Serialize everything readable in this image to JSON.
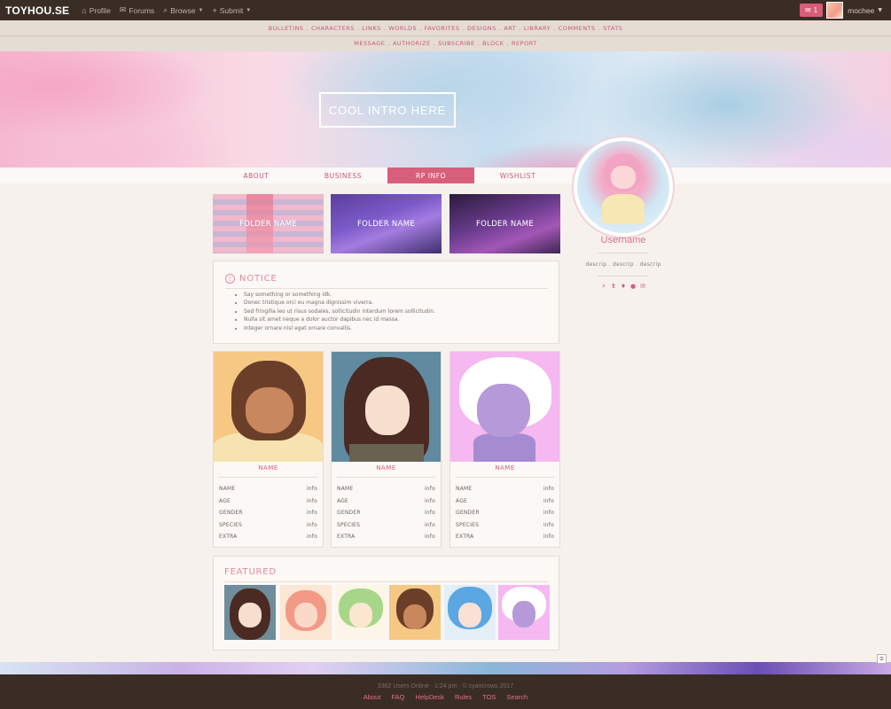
{
  "topbar": {
    "brand": "TOYHOU.SE",
    "nav": [
      {
        "label": "Profile",
        "icon": "home-icon"
      },
      {
        "label": "Forums",
        "icon": "chat-icon"
      },
      {
        "label": "Browse",
        "icon": "search-icon"
      },
      {
        "label": "Submit",
        "icon": "plus-icon"
      }
    ],
    "mail_count": "1",
    "username": "mochee"
  },
  "subnav": {
    "row1": [
      "BULLETINS",
      "CHARACTERS",
      "LINKS",
      "WORLDS",
      "FAVORITES",
      "DESIGNS",
      "ART",
      "LIBRARY",
      "COMMENTS",
      "STATS"
    ],
    "row2": [
      "MESSAGE",
      "AUTHORIZE",
      "SUBSCRIBE",
      "BLOCK",
      "REPORT"
    ],
    "separator": "."
  },
  "banner": {
    "intro": "COOL INTRO HERE"
  },
  "tabs": [
    "ABOUT",
    "BUSINESS",
    "RP INFO",
    "WISHLIST"
  ],
  "active_tab": "RP INFO",
  "aside": {
    "name": "Username",
    "descrip": "descrip . descrip . descrip",
    "social": [
      "bolt-icon",
      "tumblr-icon",
      "twitter-icon",
      "paw-icon",
      "mail-icon"
    ]
  },
  "folders": [
    "FOLDER NAME",
    "FOLDER NAME",
    "FOLDER NAME"
  ],
  "notice": {
    "title": "NOTICE",
    "items": [
      "Say something or something idk.",
      "Donec tristique orci eu magna dignissim viverra.",
      "Sed fringilla leo ut risus sodales, sollicitudin interdum lorem sollicitudin.",
      "Nulla sit amet neque a dolor auctor dapibus nec id massa.",
      "Integer ornare nisl eget ornare convallis."
    ]
  },
  "cards": [
    {
      "name": "NAME",
      "rows": [
        [
          "NAME",
          "info"
        ],
        [
          "AGE",
          "info"
        ],
        [
          "GENDER",
          "info"
        ],
        [
          "SPECIES",
          "info"
        ],
        [
          "EXTRA",
          "info"
        ]
      ]
    },
    {
      "name": "NAME",
      "rows": [
        [
          "NAME",
          "info"
        ],
        [
          "AGE",
          "info"
        ],
        [
          "GENDER",
          "info"
        ],
        [
          "SPECIES",
          "info"
        ],
        [
          "EXTRA",
          "info"
        ]
      ]
    },
    {
      "name": "NAME",
      "rows": [
        [
          "NAME",
          "info"
        ],
        [
          "AGE",
          "info"
        ],
        [
          "GENDER",
          "info"
        ],
        [
          "SPECIES",
          "info"
        ],
        [
          "EXTRA",
          "info"
        ]
      ]
    }
  ],
  "featured": {
    "title": "FEATURED",
    "count": 6
  },
  "footer": {
    "status": "3362 Users Online · 1:24 pm · © cyancrows 2017",
    "links": [
      "About",
      "FAQ",
      "HelpDesk",
      "Rules",
      "TOS",
      "Search"
    ]
  },
  "colors": {
    "accent": "#d85f7b",
    "topbar": "#3a2d25",
    "background": "#f6f1ec"
  }
}
